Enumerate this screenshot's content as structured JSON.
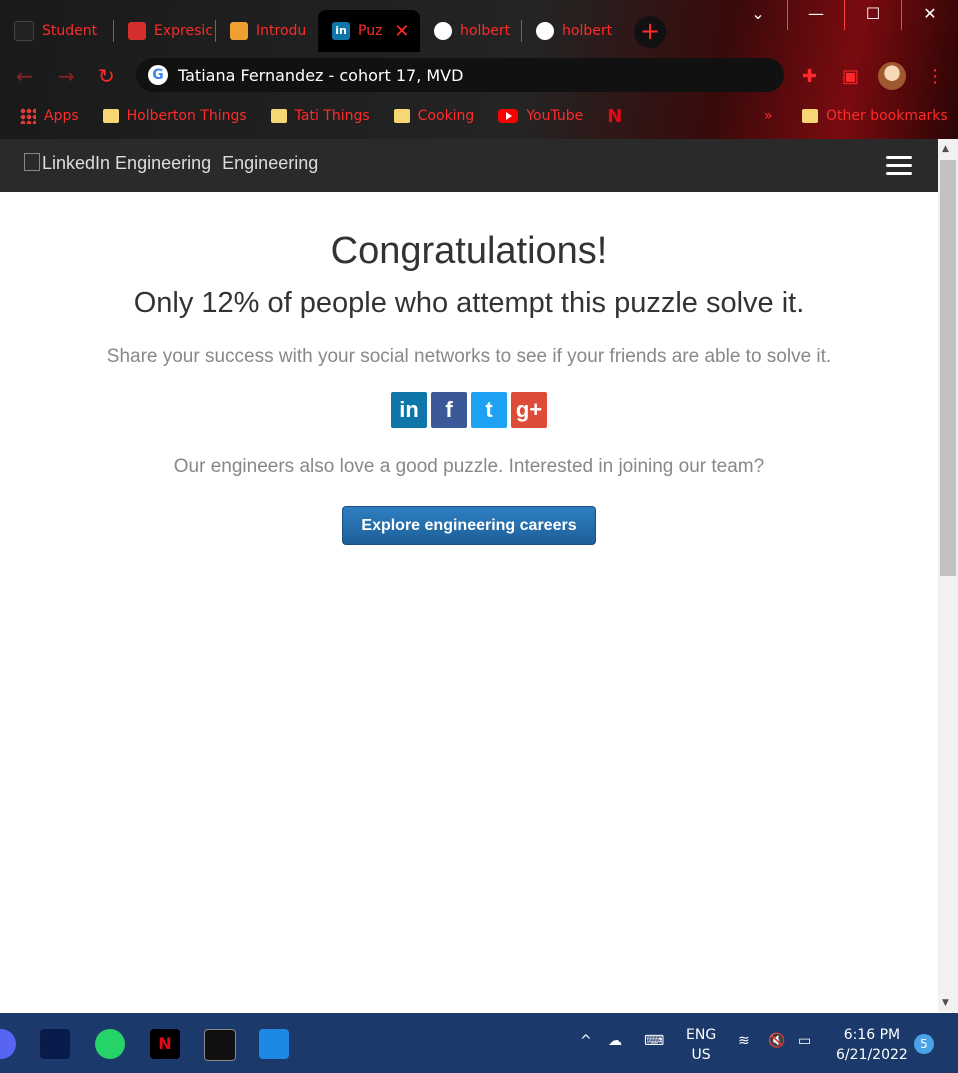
{
  "browser": {
    "tabs": [
      {
        "label": "Student"
      },
      {
        "label": "Expresic"
      },
      {
        "label": "Introdu"
      },
      {
        "label": "Puz"
      },
      {
        "label": "holbert"
      },
      {
        "label": "holbert"
      }
    ],
    "new_tab_label": "+",
    "window_controls": {
      "collapse": "⌄",
      "minimize": "—",
      "maximize": "☐",
      "close": "✕"
    },
    "omnibox_text": "Tatiana Fernandez - cohort 17, MVD",
    "bookmarks": [
      {
        "label": "Apps"
      },
      {
        "label": "Holberton Things"
      },
      {
        "label": "Tati Things"
      },
      {
        "label": "Cooking"
      },
      {
        "label": "YouTube"
      }
    ],
    "netflix_bookmark": "N",
    "bookmarks_overflow": "»",
    "other_bookmarks": "Other bookmarks",
    "accent": "#ff2a2a"
  },
  "site": {
    "brand_alt": "LinkedIn Engineering",
    "brand_text": "Engineering"
  },
  "page": {
    "heading": "Congratulations!",
    "subheading": "Only 12% of people who attempt this puzzle solve it.",
    "share_text": "Share your success with your social networks to see if your friends are able to solve it.",
    "social": [
      {
        "glyph": "in",
        "color": "#0e76a8"
      },
      {
        "glyph": "f",
        "color": "#3b5998"
      },
      {
        "glyph": "t",
        "color": "#1da1f2"
      },
      {
        "glyph": "g+",
        "color": "#dd4b39"
      }
    ],
    "careers_text": "Our engineers also love a good puzzle. Interested in joining our team?",
    "cta_label": "Explore engineering careers"
  },
  "taskbar": {
    "lang_line1": "ENG",
    "lang_line2": "US",
    "time": "6:16 PM",
    "date": "6/21/2022",
    "notifications": "5"
  }
}
